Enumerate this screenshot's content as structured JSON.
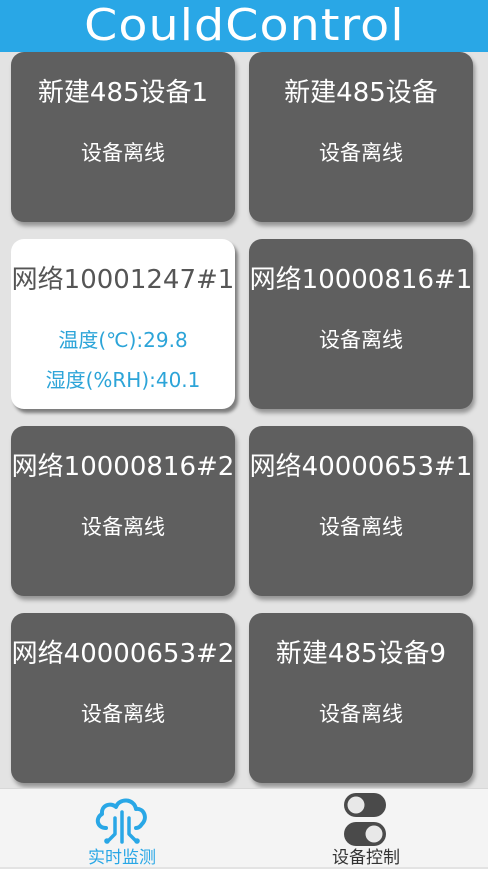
{
  "app": {
    "title": "CouldControl"
  },
  "colors": {
    "accent": "#29a7e6",
    "card_offline": "#5f5f5f",
    "card_online": "#ffffff",
    "reading": "#2ca4d8"
  },
  "devices": [
    {
      "name": "新建485设备1",
      "status": "设备离线"
    },
    {
      "name": "新建485设备",
      "status": "设备离线"
    },
    {
      "name": "网络10001247#1",
      "readings": [
        "温度(℃):29.8",
        "湿度(%RH):40.1"
      ]
    },
    {
      "name": "网络10000816#1",
      "status": "设备离线"
    },
    {
      "name": "网络10000816#2",
      "status": "设备离线"
    },
    {
      "name": "网络40000653#1",
      "status": "设备离线"
    },
    {
      "name": "网络40000653#2",
      "status": "设备离线"
    },
    {
      "name": "新建485设备9",
      "status": "设备离线"
    }
  ],
  "tabs": [
    {
      "label": "实时监测",
      "icon": "cloud-icon",
      "active": true
    },
    {
      "label": "设备控制",
      "icon": "toggle-icon",
      "active": false
    }
  ]
}
